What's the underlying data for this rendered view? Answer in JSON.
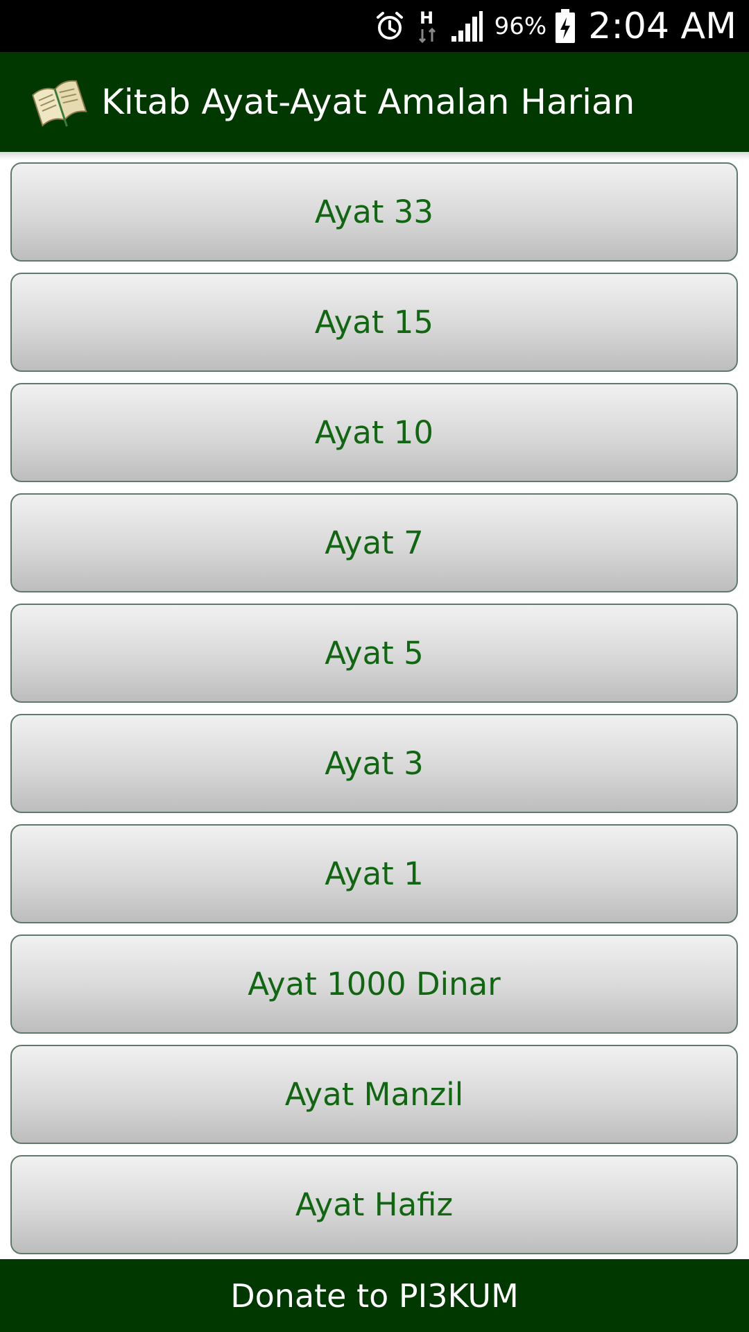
{
  "status_bar": {
    "battery_percent": "96%",
    "time": "2:04 AM",
    "icons": [
      "alarm-icon",
      "network-h-icon",
      "signal-icon",
      "battery-charging-icon"
    ]
  },
  "app_bar": {
    "title": "Kitab Ayat-Ayat Amalan Harian",
    "icon": "quran-book-icon"
  },
  "items": [
    {
      "label": "Ayat 33"
    },
    {
      "label": "Ayat 15"
    },
    {
      "label": "Ayat 10"
    },
    {
      "label": "Ayat 7"
    },
    {
      "label": "Ayat 5"
    },
    {
      "label": "Ayat 3"
    },
    {
      "label": "Ayat 1"
    },
    {
      "label": "Ayat 1000 Dinar"
    },
    {
      "label": "Ayat Manzil"
    },
    {
      "label": "Ayat Hafiz"
    }
  ],
  "footer": {
    "donate_label": "Donate to PI3KUM"
  },
  "colors": {
    "app_bar_bg": "#003800",
    "item_text": "#116611",
    "status_bar_bg": "#000000"
  }
}
